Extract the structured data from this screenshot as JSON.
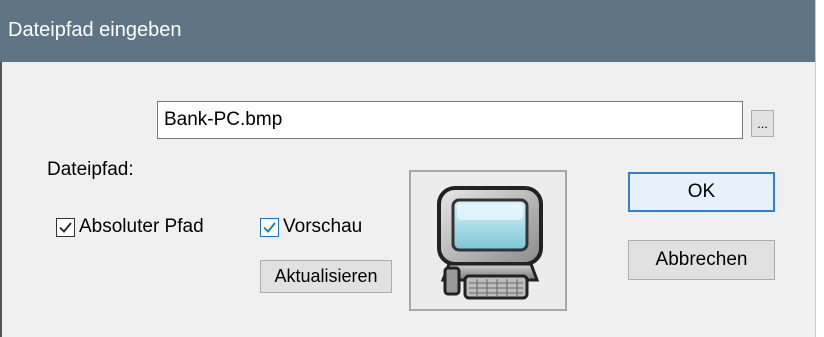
{
  "window": {
    "title": "Dateipfad eingeben"
  },
  "path": {
    "value": "Bank-PC.bmp",
    "browse_label": "..."
  },
  "labels": {
    "dateipfad": "Dateipfad:"
  },
  "options": {
    "absolute_path": {
      "label": "Absoluter Pfad",
      "checked": true
    },
    "preview": {
      "label": "Vorschau",
      "checked": true
    }
  },
  "buttons": {
    "refresh": "Aktualisieren",
    "ok": "OK",
    "cancel": "Abbrechen"
  },
  "preview": {
    "icon": "computer-icon"
  },
  "colors": {
    "titlebar": "#5f7585",
    "focus": "#2f7fd4",
    "checkbox_accent": "#1e74c8"
  }
}
